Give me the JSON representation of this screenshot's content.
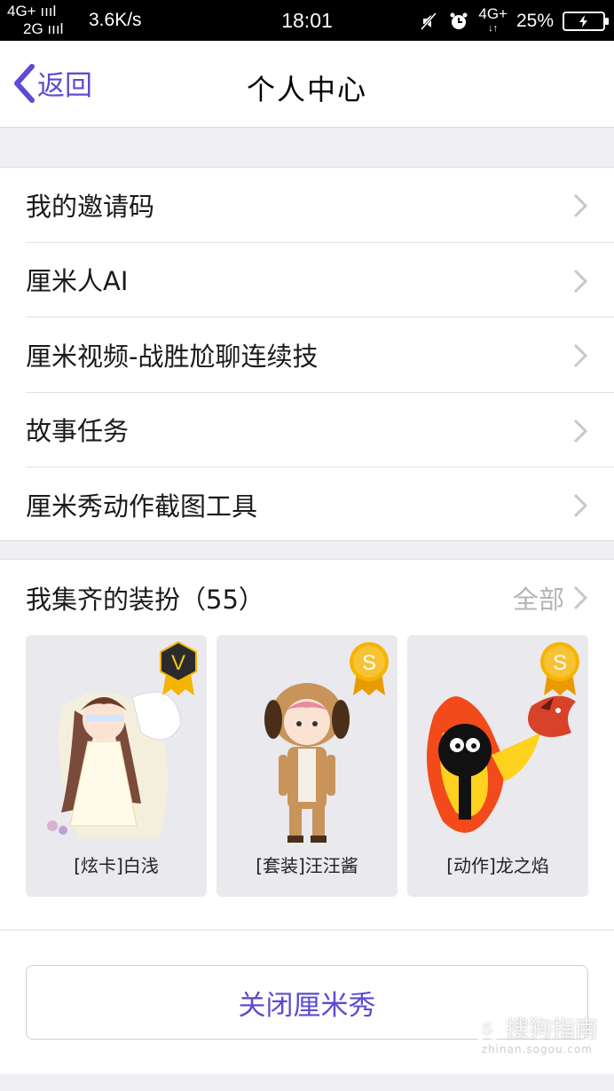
{
  "status_bar": {
    "network_top": "4G+",
    "network_bottom": "2G",
    "speed": "3.6K/s",
    "time": "18:01",
    "network_right": "4G+",
    "battery": "25%"
  },
  "nav": {
    "back_label": "返回",
    "title": "个人中心"
  },
  "menu": {
    "items": [
      {
        "label": "我的邀请码"
      },
      {
        "label": "厘米人AI"
      },
      {
        "label": "厘米视频-战胜尬聊连续技"
      },
      {
        "label": "故事任务"
      },
      {
        "label": "厘米秀动作截图工具"
      }
    ]
  },
  "outfits": {
    "header": "我集齐的装扮（55）",
    "all_label": "全部",
    "cards": [
      {
        "caption": "[炫卡]白浅",
        "badge": "V",
        "badge_color": "#2b2b2b",
        "badge_text_color": "#f5c518"
      },
      {
        "caption": "[套装]汪汪酱",
        "badge": "S",
        "badge_color": "#f5b400",
        "badge_text_color": "#ffffff"
      },
      {
        "caption": "[动作]龙之焰",
        "badge": "S",
        "badge_color": "#f5b400",
        "badge_text_color": "#ffffff"
      }
    ]
  },
  "close_button": "关闭厘米秀",
  "watermark": {
    "text": "搜狗指南",
    "sub": "zhinan.sogou.com"
  },
  "colors": {
    "accent": "#5d4cd1",
    "background": "#efeff4"
  }
}
